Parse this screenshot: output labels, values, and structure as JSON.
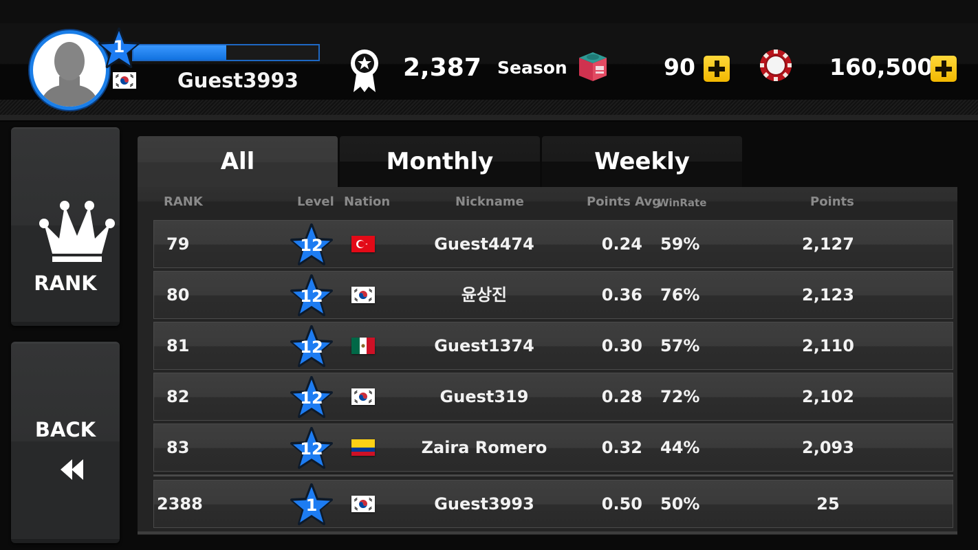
{
  "player": {
    "name": "Guest3993",
    "level": "1",
    "xp_progress": 0.5,
    "nation": "KR",
    "avatar_icon": "default-avatar-icon"
  },
  "currency": {
    "season_points": "2,387",
    "season_label": "Season",
    "season_icon": "medal-icon",
    "chalk_count": "90",
    "chalk_icon": "chalk-icon",
    "coin_count": "160,500",
    "coin_icon": "poker-chip-icon"
  },
  "sidebar": {
    "rank_label": "RANK",
    "rank_icon": "crown-icon",
    "back_label": "BACK",
    "back_icon": "rewind-icon"
  },
  "tabs": [
    {
      "label": "All",
      "active": true
    },
    {
      "label": "Monthly",
      "active": false
    },
    {
      "label": "Weekly",
      "active": false
    }
  ],
  "table": {
    "headers": {
      "rank": "RANK",
      "level": "Level",
      "nation": "Nation",
      "nickname": "Nickname",
      "points_avg": "Points Avg",
      "winrate": "WinRate",
      "points": "Points"
    },
    "rows": [
      {
        "rank": "79",
        "level": "12",
        "nation": "TR",
        "nickname": "Guest4474",
        "points_avg": "0.24",
        "winrate": "59%",
        "points": "2,127"
      },
      {
        "rank": "80",
        "level": "12",
        "nation": "KR",
        "nickname": "윤상진",
        "points_avg": "0.36",
        "winrate": "76%",
        "points": "2,123"
      },
      {
        "rank": "81",
        "level": "12",
        "nation": "MX",
        "nickname": "Guest1374",
        "points_avg": "0.30",
        "winrate": "57%",
        "points": "2,110"
      },
      {
        "rank": "82",
        "level": "12",
        "nation": "KR",
        "nickname": "Guest319",
        "points_avg": "0.28",
        "winrate": "72%",
        "points": "2,102"
      },
      {
        "rank": "83",
        "level": "12",
        "nation": "CO",
        "nickname": "Zaira Romero",
        "points_avg": "0.32",
        "winrate": "44%",
        "points": "2,093"
      }
    ],
    "me": {
      "rank": "2388",
      "level": "1",
      "nation": "KR",
      "nickname": "Guest3993",
      "points_avg": "0.50",
      "winrate": "50%",
      "points": "25"
    }
  },
  "colors": {
    "accent_blue": "#1a7ee8",
    "plus_yellow": "#f2b800",
    "chip_red": "#b8141c"
  }
}
